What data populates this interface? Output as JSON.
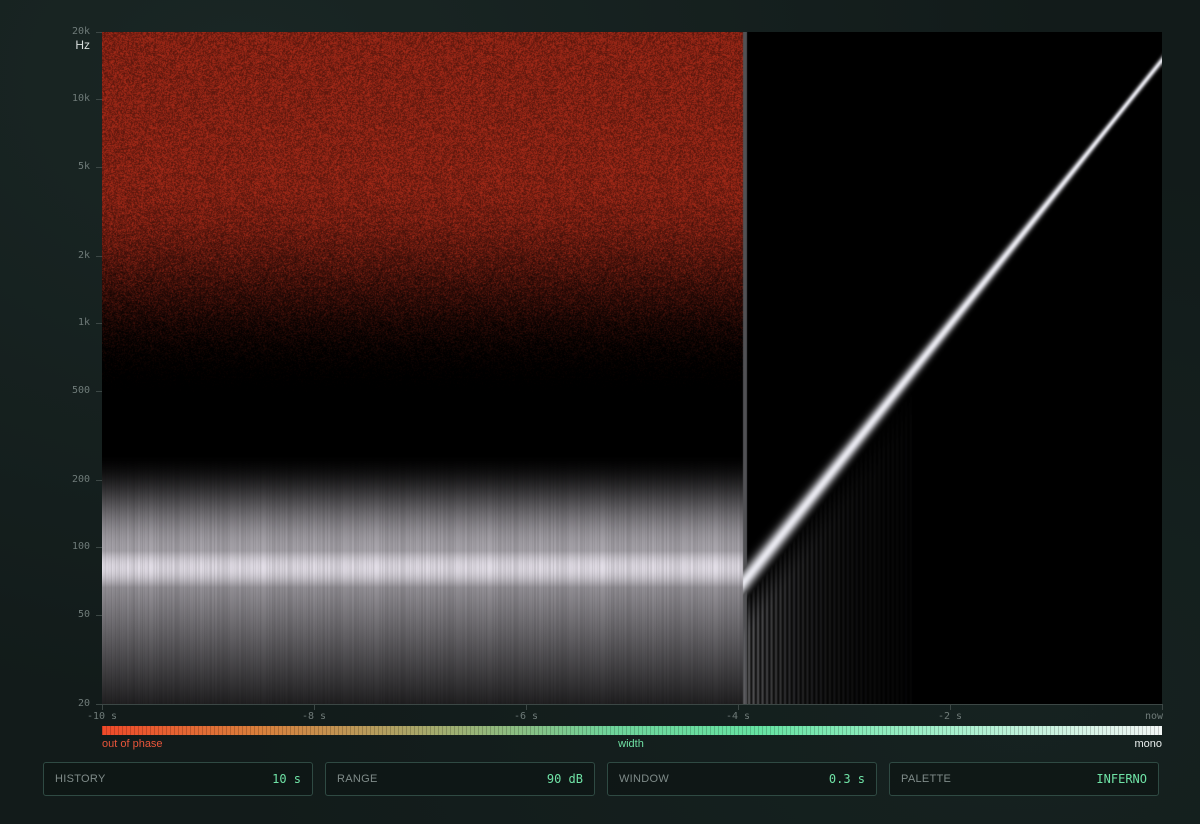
{
  "plot": {
    "y_unit": "Hz",
    "y_ticks": [
      {
        "value": 20000,
        "label": "20k"
      },
      {
        "value": 10000,
        "label": "10k"
      },
      {
        "value": 5000,
        "label": "5k"
      },
      {
        "value": 2000,
        "label": "2k"
      },
      {
        "value": 1000,
        "label": "1k"
      },
      {
        "value": 500,
        "label": "500"
      },
      {
        "value": 200,
        "label": "200"
      },
      {
        "value": 100,
        "label": "100"
      },
      {
        "value": 50,
        "label": "50"
      },
      {
        "value": 20,
        "label": "20"
      }
    ],
    "x_ticks": [
      {
        "value": -10,
        "label": "-10 s"
      },
      {
        "value": -8,
        "label": "-8 s"
      },
      {
        "value": -6,
        "label": "-6 s"
      },
      {
        "value": -4,
        "label": "-4 s"
      },
      {
        "value": -2,
        "label": "-2 s"
      },
      {
        "value": 0,
        "label": "now"
      }
    ],
    "x_range": [
      -10,
      0
    ],
    "y_range": [
      20,
      20000
    ],
    "y_scale": "log"
  },
  "legend": {
    "left": "out of phase",
    "middle": "width",
    "right": "mono",
    "colors": [
      "#f04a2a",
      "#66e3a3",
      "#f2f6f5"
    ]
  },
  "controls": [
    {
      "label": "HISTORY",
      "value": "10 s"
    },
    {
      "label": "RANGE",
      "value": "90 dB"
    },
    {
      "label": "WINDOW",
      "value": "0.3 s"
    },
    {
      "label": "PALETTE",
      "value": "INFERNO"
    }
  ]
}
